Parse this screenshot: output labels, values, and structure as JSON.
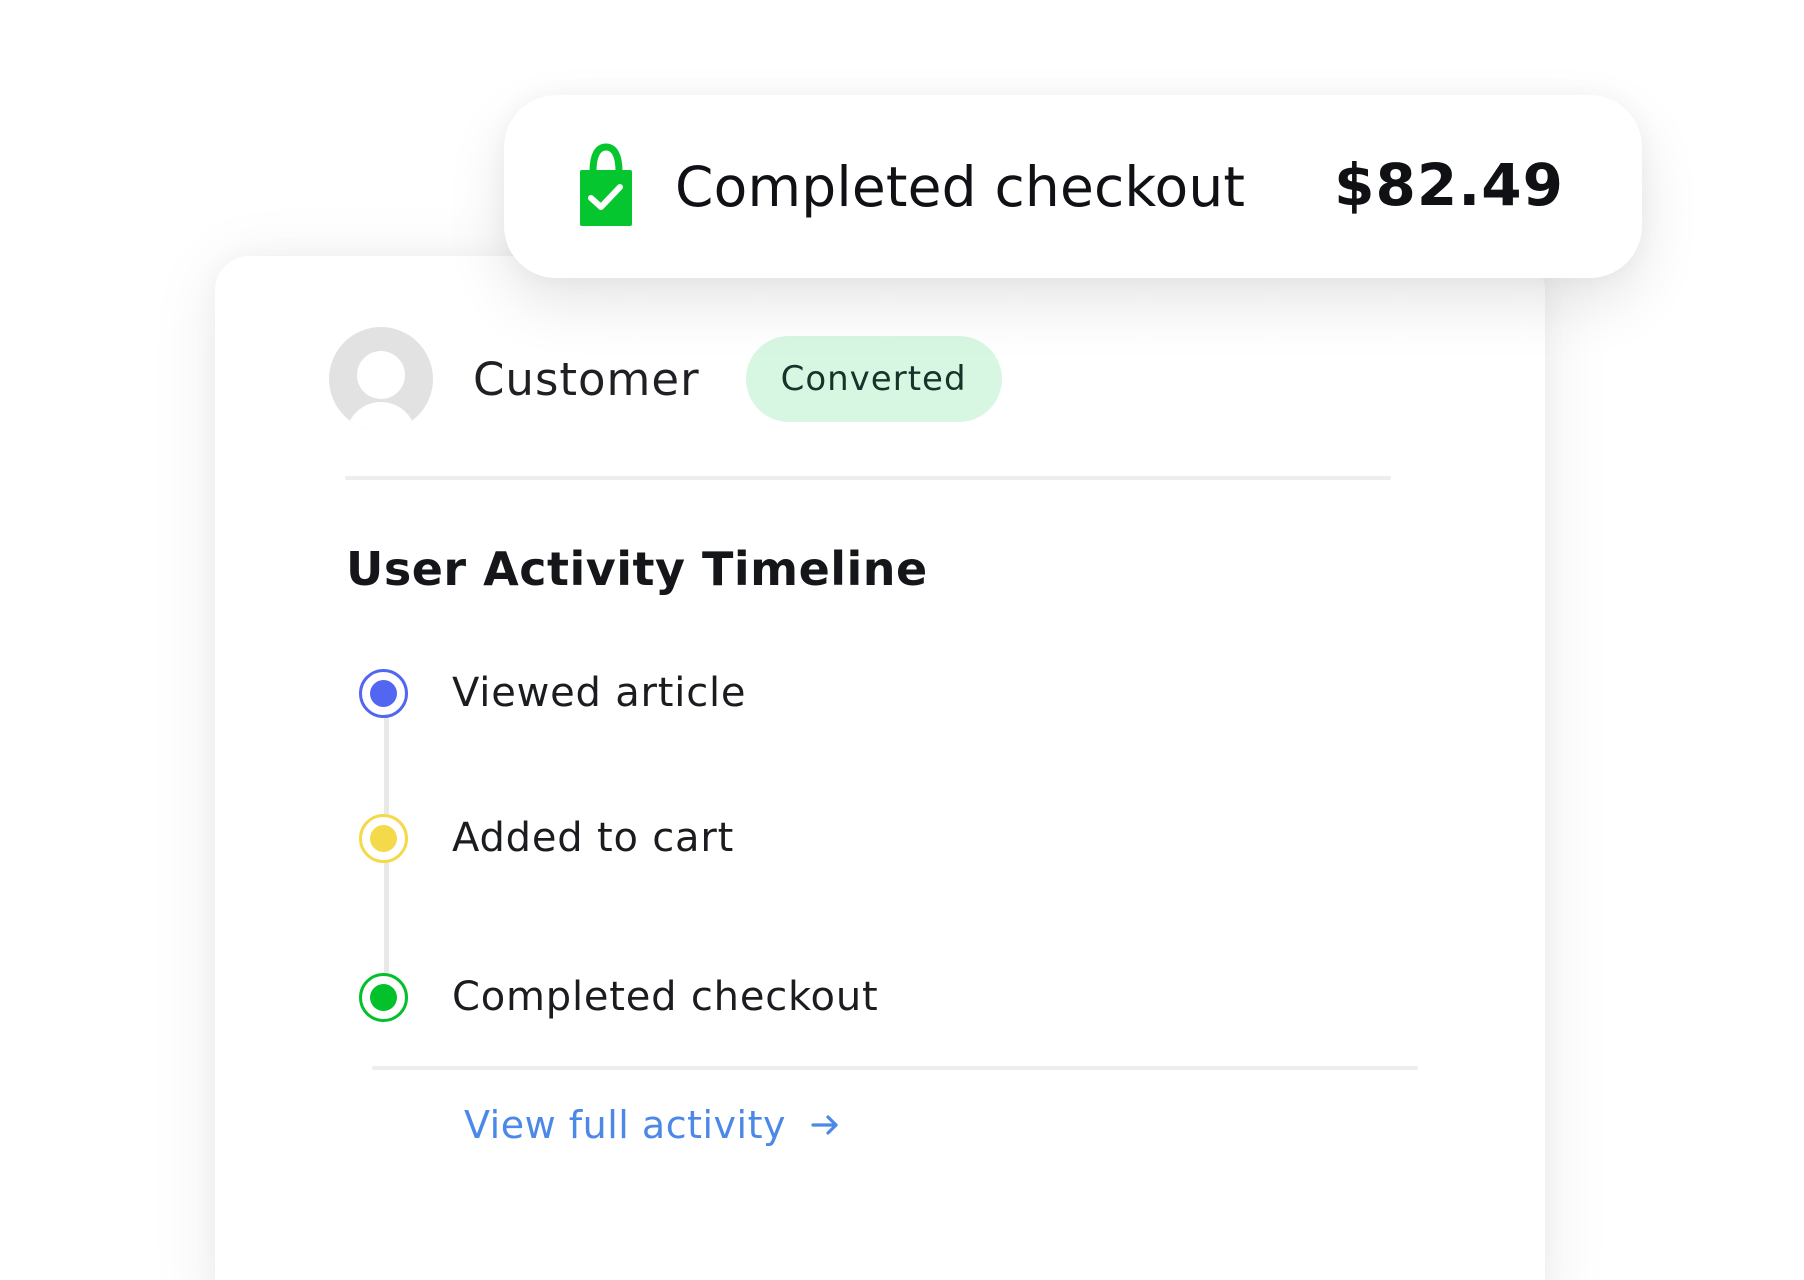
{
  "checkout_card": {
    "icon": "shopping-bag-check-icon",
    "title": "Completed checkout",
    "amount": "$82.49",
    "accent_color": "#05c62f"
  },
  "customer": {
    "avatar_icon": "user-avatar-icon",
    "name": "Customer",
    "status": "Converted",
    "status_bg_color": "#d7f7e3",
    "status_text_color": "#17332a"
  },
  "timeline": {
    "title": "User Activity Timeline",
    "items": [
      {
        "label": "Viewed article",
        "dot_color": "#5266f2",
        "icon": "timeline-dot-icon"
      },
      {
        "label": "Added to cart",
        "dot_color": "#f4d94a",
        "icon": "timeline-dot-icon"
      },
      {
        "label": "Completed checkout",
        "dot_color": "#03c12b",
        "icon": "timeline-dot-icon"
      }
    ]
  },
  "footer": {
    "link_label": "View full activity",
    "link_icon": "arrow-right-icon",
    "link_color": "#4c88e8"
  }
}
